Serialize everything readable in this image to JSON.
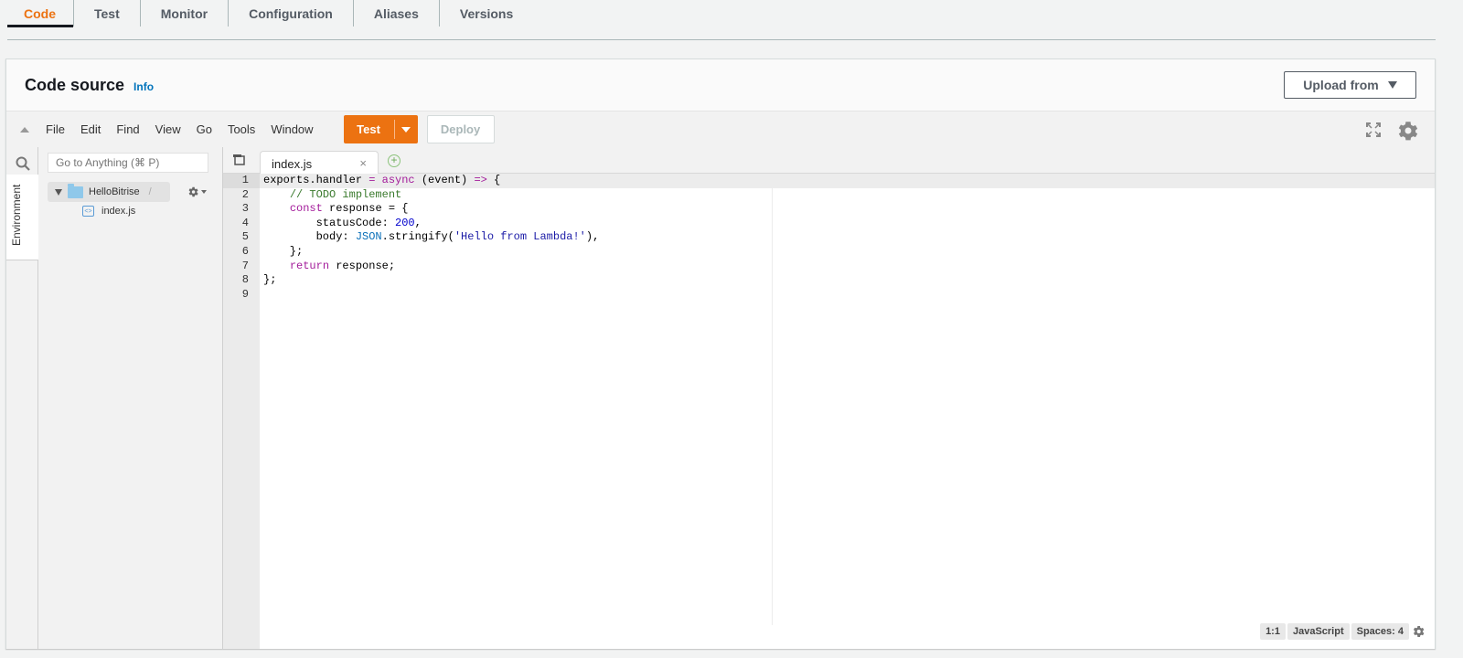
{
  "tabs": [
    {
      "label": "Code",
      "active": true
    },
    {
      "label": "Test"
    },
    {
      "label": "Monitor"
    },
    {
      "label": "Configuration"
    },
    {
      "label": "Aliases"
    },
    {
      "label": "Versions"
    }
  ],
  "panel": {
    "title": "Code source",
    "info_label": "Info",
    "upload_label": "Upload from"
  },
  "ide_menu": [
    "File",
    "Edit",
    "Find",
    "View",
    "Go",
    "Tools",
    "Window"
  ],
  "toolbar": {
    "test_label": "Test",
    "deploy_label": "Deploy",
    "accent_color": "#ec7211"
  },
  "sidebar": {
    "environment_label": "Environment",
    "goto_placeholder": "Go to Anything (⌘ P)",
    "root_folder": "HelloBitrise",
    "root_separator": "/",
    "file": "index.js"
  },
  "editor": {
    "tab_label": "index.js",
    "line_numbers": [
      "1",
      "2",
      "3",
      "4",
      "5",
      "6",
      "7",
      "8",
      "9"
    ]
  },
  "status": {
    "cursor": "1:1",
    "language": "JavaScript",
    "spaces": "Spaces: 4"
  }
}
